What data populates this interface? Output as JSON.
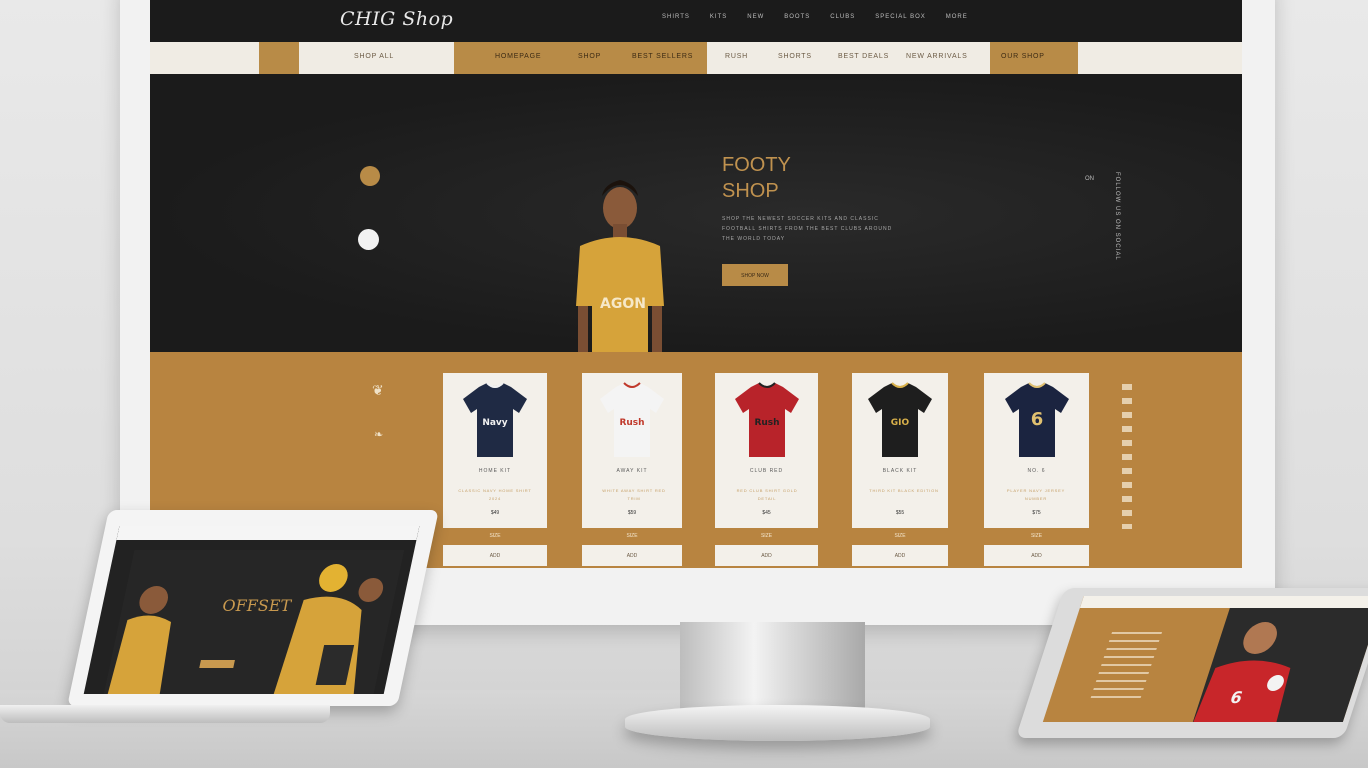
{
  "brand": {
    "logo_text": "CHIG Shop"
  },
  "topnav": [
    "SHIRTS",
    "KITS",
    "NEW",
    "BOOTS",
    "CLUBS",
    "SPECIAL BOX",
    "MORE"
  ],
  "subnav": {
    "left": "SHOP ALL",
    "gold": [
      "HOMEPAGE",
      "SHOP",
      "BEST SELLERS"
    ],
    "light": [
      "RUSH",
      "SHORTS",
      "BEST DEALS",
      "NEW ARRIVALS"
    ],
    "right": "OUR SHOP"
  },
  "hero": {
    "title_line1": "FOOTY",
    "title_line2": "SHOP",
    "shirt_text": "AGON",
    "text": "SHOP THE NEWEST SOCCER KITS AND CLASSIC FOOTBALL SHIRTS FROM THE BEST CLUBS AROUND THE WORLD TODAY",
    "button": "SHOP NOW",
    "side_vertical": "FOLLOW US ON SOCIAL",
    "side_mini": "ON"
  },
  "products": [
    {
      "name": "HOME KIT",
      "desc": "CLASSIC NAVY HOME SHIRT 2024",
      "price": "$49",
      "caption": "SIZE",
      "button": "ADD",
      "shirt": "#1f2a44",
      "trim": "#f1f1f1",
      "label": "Navy"
    },
    {
      "name": "AWAY KIT",
      "desc": "WHITE AWAY SHIRT RED TRIM",
      "price": "$59",
      "caption": "SIZE",
      "button": "ADD",
      "shirt": "#f4f4f4",
      "trim": "#c0392b",
      "label": "Rush"
    },
    {
      "name": "CLUB RED",
      "desc": "RED CLUB SHIRT GOLD DETAIL",
      "price": "$45",
      "caption": "SIZE",
      "button": "ADD",
      "shirt": "#b8232a",
      "trim": "#222222",
      "label": "Rush"
    },
    {
      "name": "BLACK KIT",
      "desc": "THIRD KIT BLACK EDITION",
      "price": "$55",
      "caption": "SIZE",
      "button": "ADD",
      "shirt": "#1e1e1e",
      "trim": "#d8b04a",
      "label": "GIO"
    },
    {
      "name": "NO. 6",
      "desc": "PLAYER NAVY JERSEY NUMBER",
      "price": "$75",
      "caption": "SIZE",
      "button": "ADD",
      "shirt": "#1b2440",
      "trim": "#e0c070",
      "label": "6"
    }
  ],
  "laptop": {
    "title": "OFFSET"
  },
  "colors": {
    "gold": "#b88440",
    "dark": "#1b1b1b",
    "cream": "#f3f0ea"
  }
}
